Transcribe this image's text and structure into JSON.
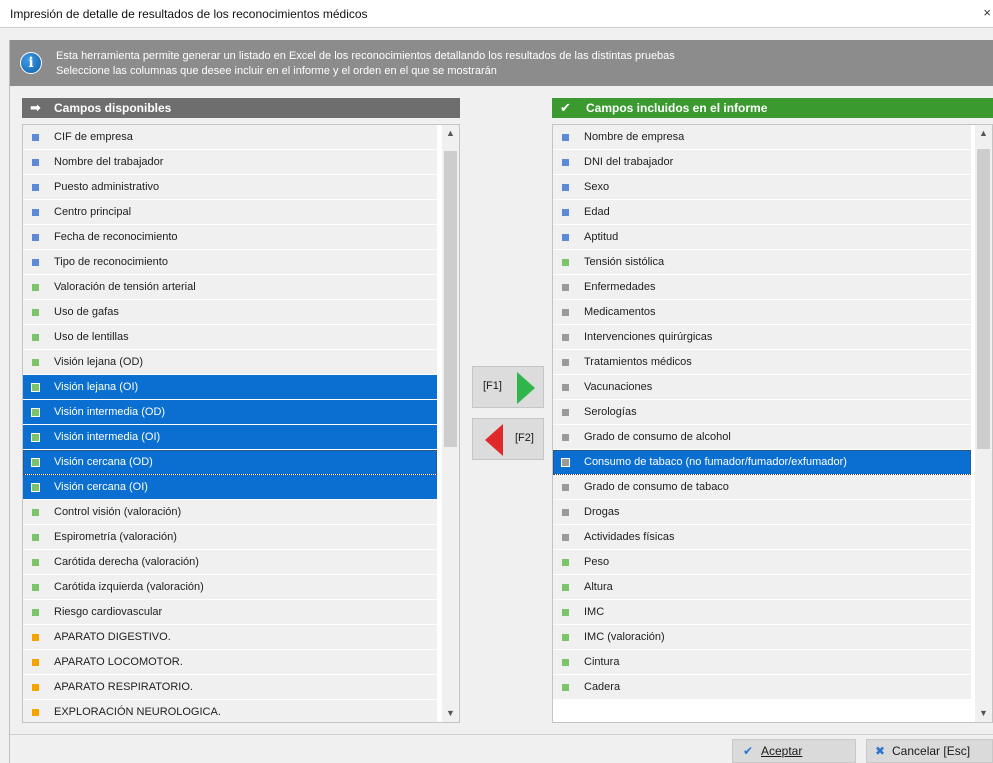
{
  "window": {
    "title": "Impresión de detalle de resultados de los reconocimientos médicos",
    "close_glyph": "×"
  },
  "info": {
    "icon": "info-icon",
    "line1": "Esta herramienta permite generar un listado en Excel de los reconocimientos detallando los resultados de las distintas pruebas",
    "line2": "Seleccione las columnas que desee incluir en el informe y el orden en el que se mostrarán"
  },
  "colors": {
    "blue": "#5c8ad6",
    "green": "#7bc46a",
    "gray": "#9a9a9a",
    "orange": "#f5a300",
    "selection": "#0a6fd1",
    "header_available": "#6e6e6e",
    "header_included": "#3a9a2f"
  },
  "available": {
    "title": "Campos disponibles",
    "items": [
      {
        "label": "CIF de empresa",
        "color": "blue",
        "selected": false
      },
      {
        "label": "Nombre del trabajador",
        "color": "blue",
        "selected": false
      },
      {
        "label": "Puesto administrativo",
        "color": "blue",
        "selected": false
      },
      {
        "label": "Centro principal",
        "color": "blue",
        "selected": false
      },
      {
        "label": "Fecha de reconocimiento",
        "color": "blue",
        "selected": false
      },
      {
        "label": "Tipo de reconocimiento",
        "color": "blue",
        "selected": false
      },
      {
        "label": "Valoración de tensión arterial",
        "color": "green",
        "selected": false
      },
      {
        "label": "Uso de gafas",
        "color": "green",
        "selected": false
      },
      {
        "label": "Uso de lentillas",
        "color": "green",
        "selected": false
      },
      {
        "label": "Visión lejana (OD)",
        "color": "green",
        "selected": false
      },
      {
        "label": "Visión lejana (OI)",
        "color": "green",
        "selected": true
      },
      {
        "label": "Visión intermedia (OD)",
        "color": "green",
        "selected": true
      },
      {
        "label": "Visión intermedia (OI)",
        "color": "green",
        "selected": true
      },
      {
        "label": "Visión cercana (OD)",
        "color": "green",
        "selected": true,
        "focus": true
      },
      {
        "label": "Visión cercana (OI)",
        "color": "green",
        "selected": true
      },
      {
        "label": "Control visión (valoración)",
        "color": "green",
        "selected": false
      },
      {
        "label": "Espirometría (valoración)",
        "color": "green",
        "selected": false
      },
      {
        "label": "Carótida derecha (valoración)",
        "color": "green",
        "selected": false
      },
      {
        "label": "Carótida izquierda (valoración)",
        "color": "green",
        "selected": false
      },
      {
        "label": "Riesgo cardiovascular",
        "color": "green",
        "selected": false
      },
      {
        "label": "APARATO DIGESTIVO.",
        "color": "orange",
        "selected": false
      },
      {
        "label": "APARATO LOCOMOTOR.",
        "color": "orange",
        "selected": false
      },
      {
        "label": "APARATO RESPIRATORIO.",
        "color": "orange",
        "selected": false
      },
      {
        "label": "EXPLORACIÓN NEUROLOGICA.",
        "color": "orange",
        "selected": false
      }
    ]
  },
  "included": {
    "title": "Campos incluidos en el informe",
    "items": [
      {
        "label": "Nombre de empresa",
        "color": "blue",
        "selected": false
      },
      {
        "label": "DNI del trabajador",
        "color": "blue",
        "selected": false
      },
      {
        "label": "Sexo",
        "color": "blue",
        "selected": false
      },
      {
        "label": "Edad",
        "color": "blue",
        "selected": false
      },
      {
        "label": "Aptitud",
        "color": "blue",
        "selected": false
      },
      {
        "label": "Tensión sistólica",
        "color": "green",
        "selected": false
      },
      {
        "label": "Enfermedades",
        "color": "gray",
        "selected": false
      },
      {
        "label": "Medicamentos",
        "color": "gray",
        "selected": false
      },
      {
        "label": "Intervenciones quirúrgicas",
        "color": "gray",
        "selected": false
      },
      {
        "label": "Tratamientos médicos",
        "color": "gray",
        "selected": false
      },
      {
        "label": "Vacunaciones",
        "color": "gray",
        "selected": false
      },
      {
        "label": "Serologías",
        "color": "gray",
        "selected": false
      },
      {
        "label": "Grado de consumo de alcohol",
        "color": "gray",
        "selected": false
      },
      {
        "label": "Consumo de tabaco (no fumador/fumador/exfumador)",
        "color": "gray",
        "selected": true,
        "focus": true
      },
      {
        "label": "Grado de consumo de tabaco",
        "color": "gray",
        "selected": false
      },
      {
        "label": "Drogas",
        "color": "gray",
        "selected": false
      },
      {
        "label": "Actividades físicas",
        "color": "gray",
        "selected": false
      },
      {
        "label": "Peso",
        "color": "green",
        "selected": false
      },
      {
        "label": "Altura",
        "color": "green",
        "selected": false
      },
      {
        "label": "IMC",
        "color": "green",
        "selected": false
      },
      {
        "label": "IMC (valoración)",
        "color": "green",
        "selected": false
      },
      {
        "label": "Cintura",
        "color": "green",
        "selected": false
      },
      {
        "label": "Cadera",
        "color": "green",
        "selected": false
      }
    ]
  },
  "move": {
    "add_key": "[F1]",
    "remove_key": "[F2]"
  },
  "footer": {
    "accept_label": "Aceptar",
    "cancel_label": "Cancelar [Esc]"
  }
}
